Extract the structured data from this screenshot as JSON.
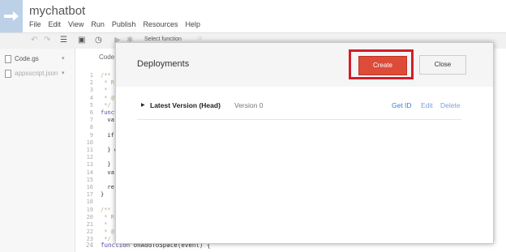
{
  "app": {
    "title": "mychatbot"
  },
  "menu": [
    "File",
    "Edit",
    "View",
    "Run",
    "Publish",
    "Resources",
    "Help"
  ],
  "toolbar": {
    "select_function": "Select function"
  },
  "files": [
    {
      "name": "Code.gs"
    },
    {
      "name": "appsscript.json"
    }
  ],
  "editor": {
    "tab_label": "Code",
    "lines": [
      {
        "n": "1",
        "text": "/**",
        "cls": "cmt"
      },
      {
        "n": "2",
        "text": " * R",
        "cls": "cmt"
      },
      {
        "n": "3",
        "text": " *",
        "cls": "cmt"
      },
      {
        "n": "4",
        "text": " * @",
        "cls": "cmt"
      },
      {
        "n": "5",
        "text": " */",
        "cls": "cmt"
      },
      {
        "n": "6",
        "text": "functio",
        "cls": "kw"
      },
      {
        "n": "7",
        "text": "  va",
        "cls": "plain"
      },
      {
        "n": "8",
        "text": "",
        "cls": "plain"
      },
      {
        "n": "9",
        "text": "  if",
        "cls": "plain"
      },
      {
        "n": "10",
        "text": "    ",
        "cls": "plain"
      },
      {
        "n": "11",
        "text": "  } e",
        "cls": "plain"
      },
      {
        "n": "12",
        "text": "    ",
        "cls": "plain"
      },
      {
        "n": "13",
        "text": "  }",
        "cls": "plain"
      },
      {
        "n": "14",
        "text": "  va",
        "cls": "plain"
      },
      {
        "n": "15",
        "text": "",
        "cls": "plain"
      },
      {
        "n": "16",
        "text": "  re",
        "cls": "plain"
      },
      {
        "n": "17",
        "text": "}",
        "cls": "plain"
      },
      {
        "n": "18",
        "text": "",
        "cls": "plain"
      },
      {
        "n": "19",
        "text": "/**",
        "cls": "cmt"
      },
      {
        "n": "20",
        "text": " * R",
        "cls": "cmt"
      },
      {
        "n": "21",
        "text": " *",
        "cls": "cmt"
      },
      {
        "n": "22",
        "text": " * @",
        "cls": "cmt"
      },
      {
        "n": "23",
        "text": " */",
        "cls": "cmt"
      }
    ],
    "last_line_number": "24",
    "last_line_keyword": "function",
    "last_line_rest": " onAddToSpace(event) {"
  },
  "dialog": {
    "title": "Deployments",
    "create_label": "Create",
    "close_label": "Close",
    "deployment": {
      "name": "Latest Version (Head)",
      "version": "Version 0",
      "get_id": "Get ID",
      "edit": "Edit",
      "delete": "Delete"
    }
  },
  "colors": {
    "create": "#dd4b39",
    "highlight": "#d21d2a",
    "link": "#3c78d8"
  }
}
